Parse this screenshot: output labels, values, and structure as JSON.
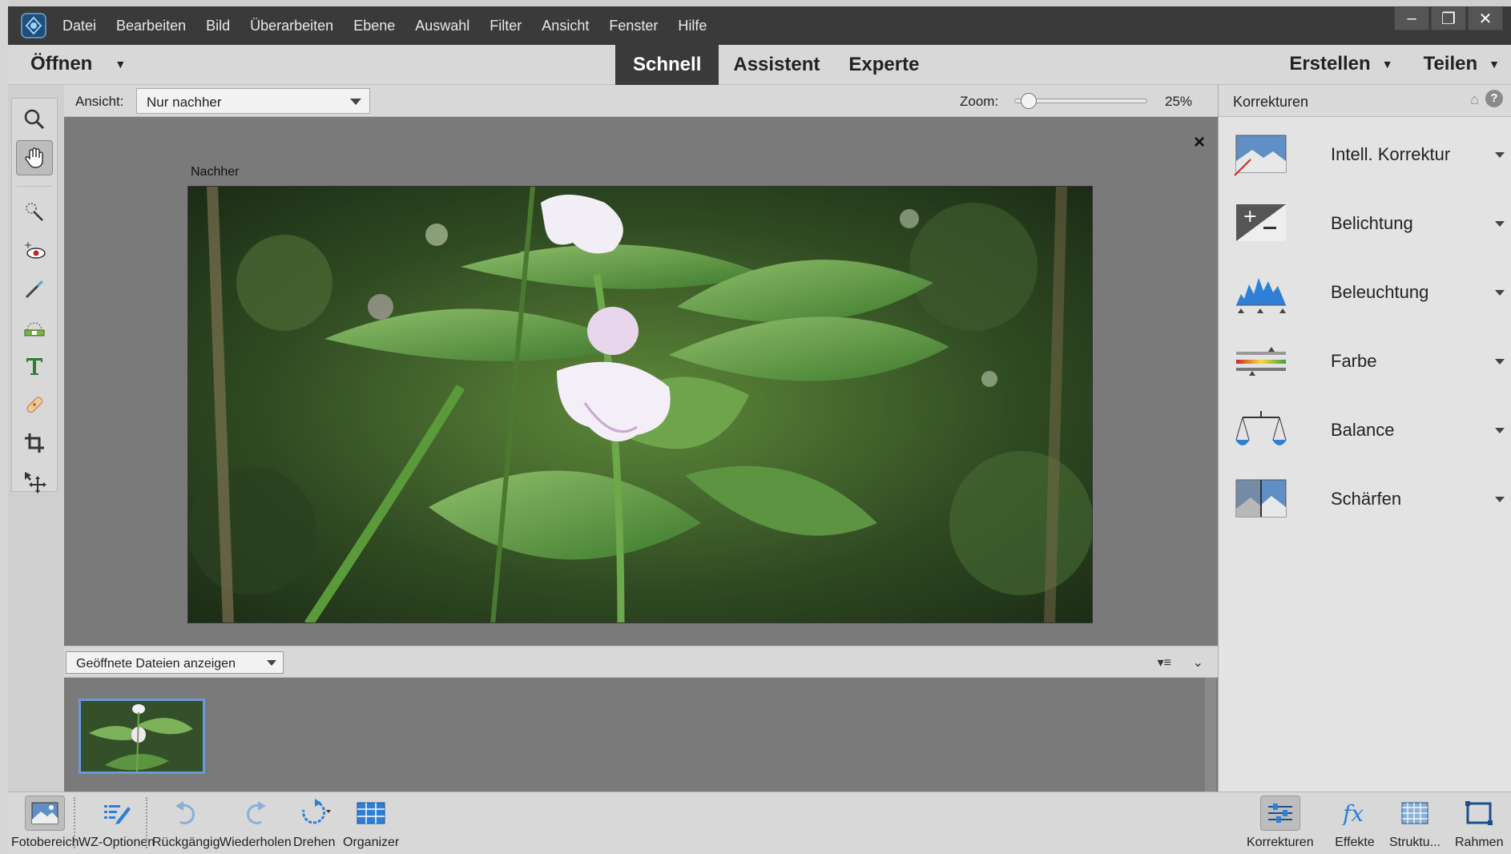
{
  "menu": [
    "Datei",
    "Bearbeiten",
    "Bild",
    "Überarbeiten",
    "Ebene",
    "Auswahl",
    "Filter",
    "Ansicht",
    "Fenster",
    "Hilfe"
  ],
  "window_controls": {
    "minimize": "–",
    "restore": "❐",
    "close": "✕"
  },
  "modebar": {
    "open_label": "Öffnen",
    "tabs": [
      {
        "label": "Schnell",
        "active": true
      },
      {
        "label": "Assistent",
        "active": false
      },
      {
        "label": "Experte",
        "active": false
      }
    ],
    "create_label": "Erstellen",
    "share_label": "Teilen"
  },
  "options": {
    "view_label": "Ansicht:",
    "view_value": "Nur nachher",
    "zoom_label": "Zoom:",
    "zoom_value": "25%",
    "zoom_fraction": 0.05
  },
  "canvas": {
    "after_label": "Nachher",
    "close_glyph": "×"
  },
  "bin": {
    "select_value": "Geöffnete Dateien anzeigen",
    "menu_glyph": "▾≡",
    "collapse_glyph": "⌄"
  },
  "panel": {
    "title": "Korrekturen",
    "items": [
      {
        "label": "Intell. Korrektur",
        "icon": "smart-fix-icon"
      },
      {
        "label": "Belichtung",
        "icon": "exposure-icon"
      },
      {
        "label": "Beleuchtung",
        "icon": "lighting-icon"
      },
      {
        "label": "Farbe",
        "icon": "color-icon"
      },
      {
        "label": "Balance",
        "icon": "balance-icon"
      },
      {
        "label": "Schärfen",
        "icon": "sharpen-icon"
      }
    ]
  },
  "taskbar": {
    "left": [
      {
        "label": "Fotobereich",
        "icon": "photo-bin-icon"
      },
      {
        "label": "WZ-Optionen",
        "icon": "tool-options-icon"
      },
      {
        "label": "Rückgängig",
        "icon": "undo-icon"
      },
      {
        "label": "Wiederholen",
        "icon": "redo-icon"
      },
      {
        "label": "Drehen",
        "icon": "rotate-icon"
      },
      {
        "label": "Organizer",
        "icon": "organizer-icon"
      }
    ],
    "right": [
      {
        "label": "Korrekturen",
        "icon": "adjustments-icon"
      },
      {
        "label": "Effekte",
        "icon": "effects-icon"
      },
      {
        "label": "Struktu...",
        "icon": "textures-icon"
      },
      {
        "label": "Rahmen",
        "icon": "frames-icon"
      }
    ]
  },
  "colors": {
    "accent": "#3a3a3a",
    "selection": "#6a9bd8",
    "icon_blue": "#2f7fd6"
  }
}
